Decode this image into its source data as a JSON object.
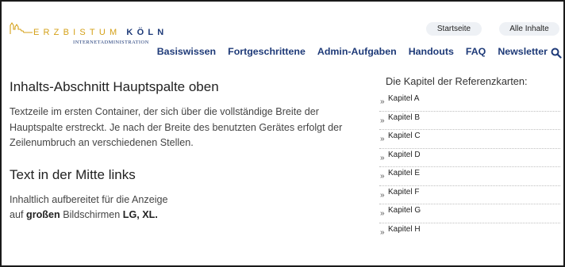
{
  "header": {
    "logo": {
      "text_gold": "ERZBISTUM",
      "text_blue": "KÖLN",
      "subtitle": "INTERNETADMINISTRATION"
    },
    "top_links": {
      "home": "Startseite",
      "all": "Alle Inhalte"
    },
    "nav": [
      "Basiswissen",
      "Fortgeschrittene",
      "Admin-Aufgaben",
      "Handouts",
      "FAQ",
      "Newsletter"
    ],
    "search_icon": "search-icon"
  },
  "main": {
    "section1": {
      "title": "Inhalts-Abschnitt Hauptspalte oben",
      "text": "Textzeile im ersten Container, der sich über die vollständige Breite der Hauptspalte erstreckt. Je nach der Breite des benutzten Gerätes erfolgt der Zeilenumbruch an verschiedenen Stellen."
    },
    "section2": {
      "title": "Text in der Mitte links",
      "line1": "Inhaltlich aufbereitet für die Anzeige",
      "line2_prefix": "auf",
      "line2_bold1": "großen",
      "line2_mid": "Bildschirmen",
      "line2_bold2": "LG, XL."
    }
  },
  "sidebar": {
    "title": "Die Kapitel der Referenzkarten:",
    "arrow": "»",
    "items": [
      "Kapitel A",
      "Kapitel B",
      "Kapitel C",
      "Kapitel D",
      "Kapitel E",
      "Kapitel F",
      "Kapitel G",
      "Kapitel H"
    ]
  },
  "colors": {
    "brand_blue": "#1e3a78",
    "brand_gold": "#d4a017",
    "pill_bg": "#eef1f5"
  }
}
